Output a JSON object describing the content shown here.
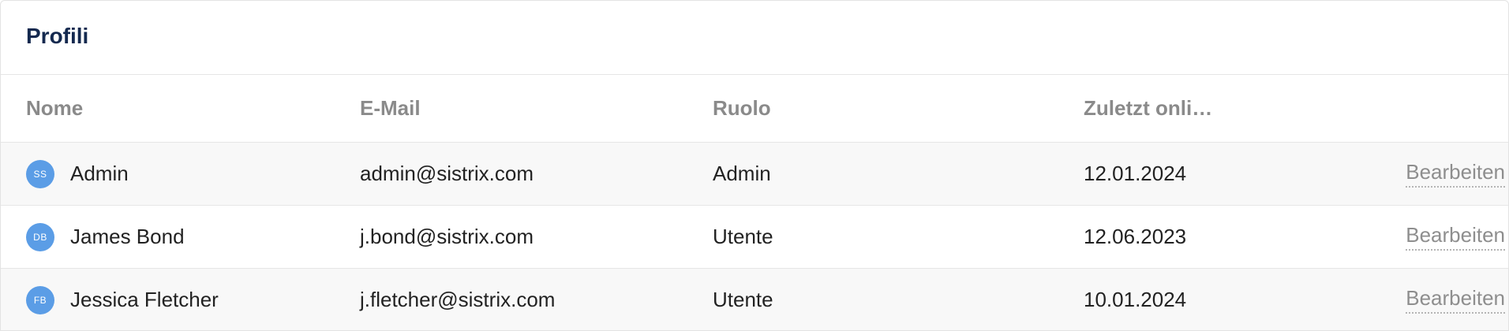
{
  "panel": {
    "title": "Profili"
  },
  "table": {
    "headers": {
      "name": "Nome",
      "email": "E-Mail",
      "role": "Ruolo",
      "last_online": "Zuletzt onli…"
    },
    "rows": [
      {
        "initials": "SS",
        "name": "Admin",
        "email": "admin@sistrix.com",
        "role": "Admin",
        "last_online": "12.01.2024",
        "action": "Bearbeiten"
      },
      {
        "initials": "DB",
        "name": "James Bond",
        "email": "j.bond@sistrix.com",
        "role": "Utente",
        "last_online": "12.06.2023",
        "action": "Bearbeiten"
      },
      {
        "initials": "FB",
        "name": "Jessica Fletcher",
        "email": "j.fletcher@sistrix.com",
        "role": "Utente",
        "last_online": "10.01.2024",
        "action": "Bearbeiten"
      }
    ]
  },
  "colors": {
    "title": "#14294f",
    "avatar": "#5b9de6",
    "header_text": "#8a8a8a",
    "link": "#8e8e8e",
    "row_shade": "#f8f8f8"
  }
}
